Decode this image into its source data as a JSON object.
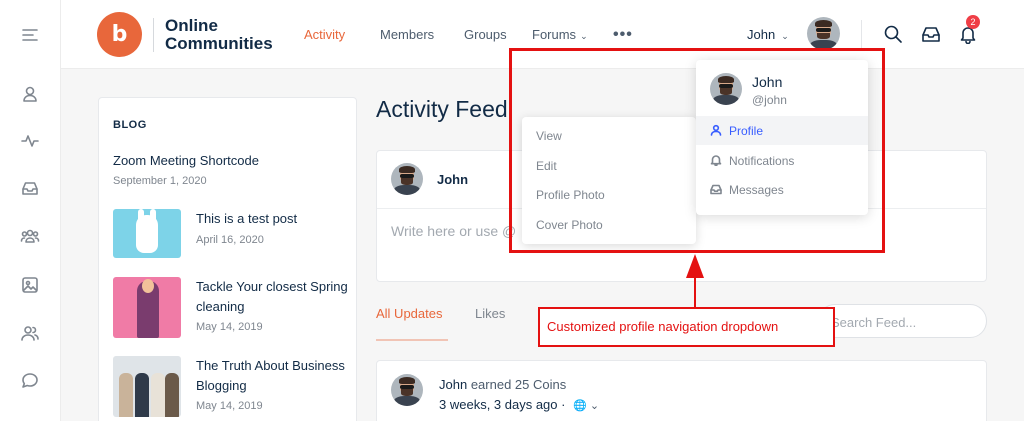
{
  "header": {
    "logo_glyph": "b",
    "logo_line1": "Online",
    "logo_line2": "Communities",
    "nav": [
      {
        "label": "Activity",
        "active": true
      },
      {
        "label": "Members"
      },
      {
        "label": "Groups"
      },
      {
        "label": "Forums"
      }
    ],
    "more_label": "•••",
    "user_name": "John",
    "notification_count": "2",
    "icons": [
      "search-icon",
      "inbox-icon",
      "bell-icon"
    ]
  },
  "rail": {
    "icons": [
      "menu-toggle-icon",
      "profile-icon",
      "activity-icon",
      "messages-icon",
      "groups-icon",
      "photos-icon",
      "members-icon",
      "forums-icon"
    ]
  },
  "blog": {
    "title": "BLOG",
    "posts": [
      {
        "title": "Zoom Meeting Shortcode",
        "date": "September 1, 2020"
      },
      {
        "title": "This is a test post",
        "date": "April 16, 2020"
      },
      {
        "title_line1": "Tackle Your closest Spring",
        "title_line2": "cleaning",
        "date": "May 14, 2019"
      },
      {
        "title_line1": "The Truth About Business",
        "title_line2": "Blogging",
        "date": "May 14, 2019"
      }
    ]
  },
  "feed": {
    "title": "Activity Feed",
    "composer_name": "John",
    "composer_placeholder": "Write here or use @",
    "tabs": [
      {
        "label": "All Updates",
        "active": true
      },
      {
        "label": "Likes"
      }
    ],
    "search_placeholder": "Search Feed...",
    "activity": {
      "user": "John",
      "action": " earned 25 Coins",
      "time": "3 weeks, 3 days ago",
      "privacy_glyph": "🌐 ⌄"
    }
  },
  "profile_menu": {
    "name": "John",
    "handle": "@john",
    "items": [
      {
        "label": "Profile",
        "icon": "user-icon",
        "active": true
      },
      {
        "label": "Notifications",
        "icon": "bell-icon"
      },
      {
        "label": "Messages",
        "icon": "inbox-icon"
      }
    ],
    "submenu": [
      "View",
      "Edit",
      "Profile Photo",
      "Cover Photo"
    ]
  },
  "annotation": {
    "callout": "Customized profile navigation dropdown",
    "color": "#e41111"
  },
  "colors": {
    "accent": "#e8673b",
    "link_active": "#385dff",
    "badge": "#ef3e46"
  }
}
